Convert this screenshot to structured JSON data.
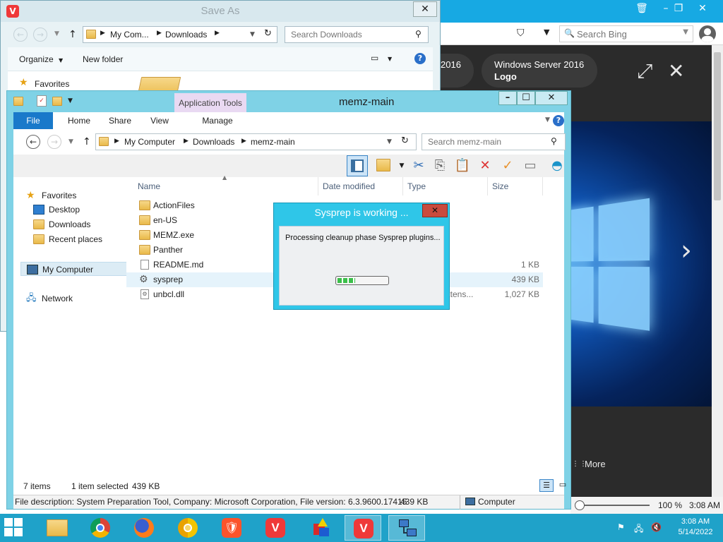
{
  "browser": {
    "search_placeholder": "Search Bing",
    "chip1": "2016",
    "chip2_line1": "Windows Server 2016",
    "chip2_line2": "Logo",
    "more": "More",
    "zoom": "100 %",
    "time": "3:08 AM"
  },
  "saveas": {
    "title": "Save As",
    "breadcrumb": [
      "My Com...",
      "Downloads"
    ],
    "search_placeholder": "Search Downloads",
    "organize": "Organize",
    "new_folder": "New folder",
    "favorites": "Favorites"
  },
  "explorer": {
    "title": "memz-main",
    "context_tab": "Application Tools",
    "tabs": [
      "File",
      "Home",
      "Share",
      "View",
      "Manage"
    ],
    "breadcrumb": [
      "My Computer",
      "Downloads",
      "memz-main"
    ],
    "search_placeholder": "Search memz-main",
    "nav": {
      "favorites": "Favorites",
      "desktop": "Desktop",
      "downloads": "Downloads",
      "recent": "Recent places",
      "computer": "My Computer",
      "network": "Network"
    },
    "columns": [
      "Name",
      "Date modified",
      "Type",
      "Size"
    ],
    "files": [
      {
        "name": "ActionFiles",
        "type": "",
        "size": ""
      },
      {
        "name": "en-US",
        "type": "",
        "size": ""
      },
      {
        "name": "MEMZ.exe",
        "type": "",
        "size": ""
      },
      {
        "name": "Panther",
        "type": "",
        "size": ""
      },
      {
        "name": "README.md",
        "type": "",
        "size": "1 KB"
      },
      {
        "name": "sysprep",
        "type": "",
        "size": "439 KB"
      },
      {
        "name": "unbcl.dll",
        "type": "extens...",
        "size": "1,027 KB"
      }
    ],
    "status": {
      "items": "7 items",
      "selected": "1 item selected",
      "selected_size": "439 KB"
    },
    "bottom_status": {
      "description": "File description: System Preparation Tool, Company: Microsoft Corporation, File version: 6.3.9600.17415",
      "size": "439 KB",
      "location": "Computer"
    }
  },
  "sysprep": {
    "title": "Sysprep is working ...",
    "message": "Processing cleanup phase Sysprep plugins...",
    "progress": 0.35
  },
  "taskbar": {
    "apps": [
      "file-explorer",
      "chrome",
      "firefox",
      "chromium",
      "brave",
      "vivaldi",
      "paint-3d",
      "vivaldi",
      "network"
    ],
    "time": "3:08 AM",
    "date": "5/14/2022"
  }
}
